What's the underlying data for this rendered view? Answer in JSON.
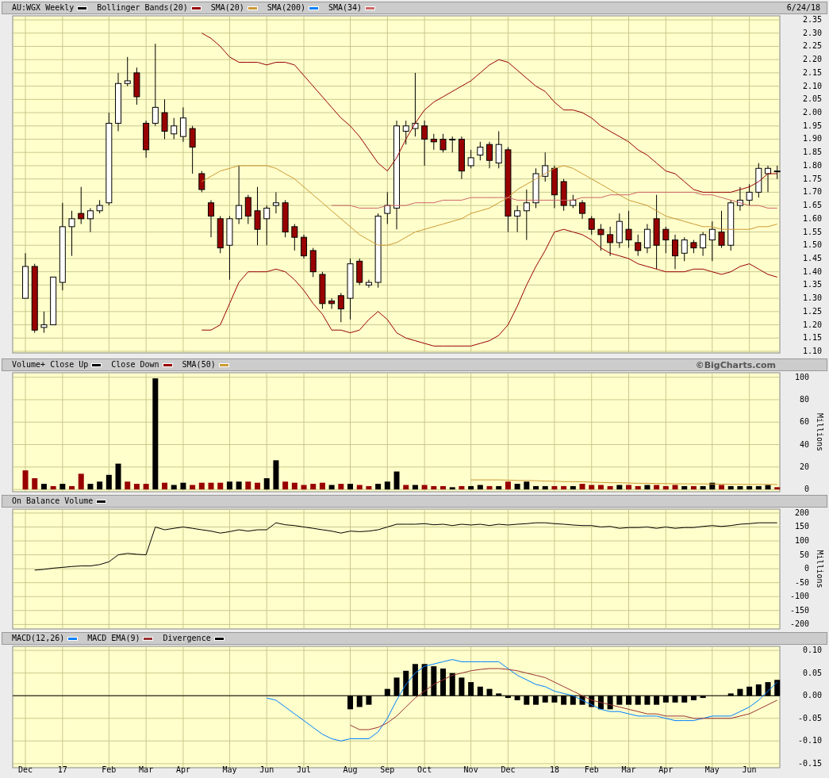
{
  "panels": [
    {
      "legend": [
        {
          "label": "AU:WGX Weekly",
          "color": "#000000"
        },
        {
          "label": "Bollinger Bands(20)",
          "color": "#990000"
        },
        {
          "label": "SMA(20)",
          "color": "#cc9933"
        },
        {
          "label": "SMA(200)",
          "color": "#0080ff"
        },
        {
          "label": "SMA(34)",
          "color": "#cc6666"
        }
      ],
      "date": "6/24/18",
      "chart_data": {
        "type": "candlestick",
        "grid": true,
        "ylim": [
          1.094,
          2.365
        ],
        "yticks": [
          {
            "value": 2.35,
            "label": "2.35"
          },
          {
            "value": 2.3,
            "label": "2.30"
          },
          {
            "value": 2.25,
            "label": "2.25"
          },
          {
            "value": 2.2,
            "label": "2.20"
          },
          {
            "value": 2.15,
            "label": "2.15"
          },
          {
            "value": 2.1,
            "label": "2.10"
          },
          {
            "value": 2.05,
            "label": "2.05"
          },
          {
            "value": 2.0,
            "label": "2.00"
          },
          {
            "value": 1.95,
            "label": "1.95"
          },
          {
            "value": 1.9,
            "label": "1.90"
          },
          {
            "value": 1.85,
            "label": "1.85"
          },
          {
            "value": 1.8,
            "label": "1.80"
          },
          {
            "value": 1.75,
            "label": "1.75"
          },
          {
            "value": 1.7,
            "label": "1.70"
          },
          {
            "value": 1.65,
            "label": "1.65"
          },
          {
            "value": 1.6,
            "label": "1.60"
          },
          {
            "value": 1.55,
            "label": "1.55"
          },
          {
            "value": 1.5,
            "label": "1.50"
          },
          {
            "value": 1.45,
            "label": "1.45"
          },
          {
            "value": 1.4,
            "label": "1.40"
          },
          {
            "value": 1.35,
            "label": "1.35"
          },
          {
            "value": 1.3,
            "label": "1.30"
          },
          {
            "value": 1.25,
            "label": "1.25"
          },
          {
            "value": 1.2,
            "label": "1.20"
          },
          {
            "value": 1.15,
            "label": "1.15"
          },
          {
            "value": 1.1,
            "label": "1.10"
          }
        ],
        "ohlc": [
          [
            1.3,
            1.47,
            1.3,
            1.42
          ],
          [
            1.42,
            1.43,
            1.17,
            1.18
          ],
          [
            1.19,
            1.25,
            1.17,
            1.2
          ],
          [
            1.2,
            1.38,
            1.2,
            1.38
          ],
          [
            1.36,
            1.66,
            1.33,
            1.57
          ],
          [
            1.57,
            1.63,
            1.46,
            1.6
          ],
          [
            1.62,
            1.72,
            1.58,
            1.6
          ],
          [
            1.6,
            1.64,
            1.55,
            1.63
          ],
          [
            1.63,
            1.67,
            1.62,
            1.65
          ],
          [
            1.66,
            2.0,
            1.65,
            1.96
          ],
          [
            1.96,
            2.15,
            1.93,
            2.11
          ],
          [
            2.11,
            2.21,
            2.1,
            2.12
          ],
          [
            2.15,
            2.17,
            2.03,
            2.06
          ],
          [
            1.96,
            1.97,
            1.83,
            1.86
          ],
          [
            1.96,
            2.26,
            1.95,
            2.02
          ],
          [
            2.0,
            2.05,
            1.9,
            1.93
          ],
          [
            1.92,
            1.98,
            1.9,
            1.95
          ],
          [
            1.91,
            2.02,
            1.89,
            1.98
          ],
          [
            1.94,
            1.95,
            1.77,
            1.87
          ],
          [
            1.77,
            1.78,
            1.7,
            1.71
          ],
          [
            1.66,
            1.67,
            1.53,
            1.61
          ],
          [
            1.6,
            1.61,
            1.47,
            1.49
          ],
          [
            1.5,
            1.61,
            1.37,
            1.6
          ],
          [
            1.6,
            1.8,
            1.58,
            1.65
          ],
          [
            1.68,
            1.69,
            1.58,
            1.61
          ],
          [
            1.63,
            1.72,
            1.5,
            1.56
          ],
          [
            1.6,
            1.65,
            1.5,
            1.64
          ],
          [
            1.65,
            1.7,
            1.62,
            1.66
          ],
          [
            1.66,
            1.67,
            1.53,
            1.55
          ],
          [
            1.57,
            1.58,
            1.48,
            1.53
          ],
          [
            1.53,
            1.54,
            1.45,
            1.46
          ],
          [
            1.48,
            1.49,
            1.38,
            1.4
          ],
          [
            1.39,
            1.4,
            1.26,
            1.28
          ],
          [
            1.29,
            1.3,
            1.26,
            1.28
          ],
          [
            1.31,
            1.32,
            1.21,
            1.26
          ],
          [
            1.3,
            1.45,
            1.22,
            1.43
          ],
          [
            1.44,
            1.45,
            1.35,
            1.36
          ],
          [
            1.35,
            1.37,
            1.34,
            1.36
          ],
          [
            1.36,
            1.62,
            1.34,
            1.61
          ],
          [
            1.62,
            1.7,
            1.58,
            1.65
          ],
          [
            1.64,
            1.97,
            1.56,
            1.95
          ],
          [
            1.93,
            1.97,
            1.88,
            1.95
          ],
          [
            1.94,
            2.15,
            1.91,
            1.96
          ],
          [
            1.95,
            1.97,
            1.8,
            1.9
          ],
          [
            1.9,
            1.92,
            1.86,
            1.89
          ],
          [
            1.9,
            1.92,
            1.85,
            1.86
          ],
          [
            1.9,
            1.91,
            1.85,
            1.9
          ],
          [
            1.9,
            1.91,
            1.75,
            1.78
          ],
          [
            1.8,
            1.86,
            1.79,
            1.83
          ],
          [
            1.84,
            1.89,
            1.82,
            1.87
          ],
          [
            1.88,
            1.89,
            1.79,
            1.82
          ],
          [
            1.81,
            1.93,
            1.79,
            1.88
          ],
          [
            1.86,
            1.87,
            1.55,
            1.61
          ],
          [
            1.61,
            1.65,
            1.55,
            1.63
          ],
          [
            1.63,
            1.71,
            1.52,
            1.66
          ],
          [
            1.66,
            1.79,
            1.64,
            1.77
          ],
          [
            1.76,
            1.85,
            1.74,
            1.8
          ],
          [
            1.79,
            1.8,
            1.64,
            1.69
          ],
          [
            1.74,
            1.75,
            1.63,
            1.65
          ],
          [
            1.65,
            1.69,
            1.64,
            1.67
          ],
          [
            1.66,
            1.67,
            1.6,
            1.62
          ],
          [
            1.6,
            1.61,
            1.54,
            1.56
          ],
          [
            1.56,
            1.58,
            1.48,
            1.54
          ],
          [
            1.54,
            1.57,
            1.46,
            1.51
          ],
          [
            1.51,
            1.62,
            1.49,
            1.59
          ],
          [
            1.56,
            1.63,
            1.49,
            1.52
          ],
          [
            1.51,
            1.54,
            1.46,
            1.48
          ],
          [
            1.49,
            1.58,
            1.47,
            1.56
          ],
          [
            1.6,
            1.69,
            1.41,
            1.5
          ],
          [
            1.56,
            1.57,
            1.47,
            1.52
          ],
          [
            1.52,
            1.54,
            1.41,
            1.46
          ],
          [
            1.47,
            1.53,
            1.44,
            1.52
          ],
          [
            1.51,
            1.52,
            1.47,
            1.49
          ],
          [
            1.49,
            1.55,
            1.46,
            1.54
          ],
          [
            1.52,
            1.59,
            1.44,
            1.56
          ],
          [
            1.55,
            1.63,
            1.49,
            1.5
          ],
          [
            1.5,
            1.67,
            1.48,
            1.66
          ],
          [
            1.65,
            1.72,
            1.63,
            1.67
          ],
          [
            1.67,
            1.73,
            1.65,
            1.7
          ],
          [
            1.7,
            1.81,
            1.68,
            1.79
          ],
          [
            1.77,
            1.8,
            1.7,
            1.79
          ],
          [
            1.78,
            1.8,
            1.75,
            1.78
          ]
        ],
        "series": [
          {
            "type": "line",
            "color": "#990000",
            "values": [
              null,
              null,
              null,
              null,
              null,
              null,
              null,
              null,
              null,
              null,
              null,
              null,
              null,
              null,
              null,
              null,
              null,
              null,
              null,
              2.3,
              2.28,
              2.25,
              2.21,
              2.19,
              2.19,
              2.19,
              2.18,
              2.19,
              2.19,
              2.18,
              2.14,
              2.1,
              2.06,
              2.02,
              1.98,
              1.95,
              1.91,
              1.86,
              1.81,
              1.78,
              1.83,
              1.9,
              1.96,
              2.01,
              2.04,
              2.06,
              2.08,
              2.1,
              2.12,
              2.15,
              2.18,
              2.2,
              2.19,
              2.16,
              2.13,
              2.1,
              2.08,
              2.04,
              2.01,
              2.01,
              2.0,
              1.98,
              1.95,
              1.93,
              1.91,
              1.89,
              1.86,
              1.84,
              1.81,
              1.78,
              1.77,
              1.74,
              1.71,
              1.7,
              1.7,
              1.7,
              1.7,
              1.71,
              1.72,
              1.74,
              1.77,
              1.77
            ]
          },
          {
            "type": "line",
            "color": "#990000",
            "values": [
              null,
              null,
              null,
              null,
              null,
              null,
              null,
              null,
              null,
              null,
              null,
              null,
              null,
              null,
              null,
              null,
              null,
              null,
              null,
              1.18,
              1.18,
              1.2,
              1.28,
              1.36,
              1.4,
              1.4,
              1.4,
              1.41,
              1.4,
              1.37,
              1.33,
              1.28,
              1.24,
              1.18,
              1.18,
              1.17,
              1.18,
              1.22,
              1.25,
              1.22,
              1.17,
              1.15,
              1.14,
              1.13,
              1.12,
              1.12,
              1.12,
              1.12,
              1.12,
              1.13,
              1.14,
              1.16,
              1.2,
              1.27,
              1.35,
              1.42,
              1.48,
              1.55,
              1.56,
              1.55,
              1.54,
              1.52,
              1.49,
              1.47,
              1.46,
              1.45,
              1.43,
              1.42,
              1.41,
              1.4,
              1.4,
              1.4,
              1.41,
              1.41,
              1.4,
              1.39,
              1.4,
              1.42,
              1.43,
              1.41,
              1.39,
              1.38
            ]
          },
          {
            "type": "line",
            "color": "#cc9933",
            "values": [
              null,
              null,
              null,
              null,
              null,
              null,
              null,
              null,
              null,
              null,
              null,
              null,
              null,
              null,
              null,
              null,
              null,
              null,
              null,
              1.74,
              1.76,
              1.78,
              1.79,
              1.8,
              1.8,
              1.8,
              1.8,
              1.79,
              1.77,
              1.75,
              1.72,
              1.69,
              1.66,
              1.63,
              1.6,
              1.57,
              1.54,
              1.52,
              1.5,
              1.5,
              1.51,
              1.53,
              1.55,
              1.56,
              1.57,
              1.58,
              1.59,
              1.6,
              1.62,
              1.63,
              1.64,
              1.66,
              1.68,
              1.71,
              1.73,
              1.75,
              1.77,
              1.79,
              1.8,
              1.79,
              1.77,
              1.75,
              1.73,
              1.71,
              1.69,
              1.67,
              1.66,
              1.65,
              1.63,
              1.61,
              1.6,
              1.59,
              1.58,
              1.57,
              1.57,
              1.56,
              1.56,
              1.56,
              1.56,
              1.57,
              1.57,
              1.58
            ]
          },
          {
            "type": "line",
            "color": "#cc6666",
            "values": [
              null,
              null,
              null,
              null,
              null,
              null,
              null,
              null,
              null,
              null,
              null,
              null,
              null,
              null,
              null,
              null,
              null,
              null,
              null,
              null,
              null,
              null,
              null,
              null,
              null,
              null,
              null,
              null,
              null,
              null,
              null,
              null,
              null,
              1.65,
              1.65,
              1.65,
              1.64,
              1.64,
              1.64,
              1.65,
              1.65,
              1.65,
              1.66,
              1.66,
              1.66,
              1.67,
              1.67,
              1.67,
              1.68,
              1.68,
              1.68,
              1.68,
              1.68,
              1.67,
              1.67,
              1.67,
              1.67,
              1.67,
              1.67,
              1.67,
              1.68,
              1.68,
              1.68,
              1.69,
              1.69,
              1.69,
              1.7,
              1.7,
              1.7,
              1.7,
              1.7,
              1.7,
              1.7,
              1.69,
              1.69,
              1.68,
              1.67,
              1.66,
              1.65,
              1.65,
              1.64,
              1.64
            ]
          }
        ]
      }
    },
    {
      "legend": [
        {
          "label": "Volume+ Close Up",
          "color": "#000000"
        },
        {
          "label": "Close Down",
          "color": "#990000"
        },
        {
          "label": "SMA(50)",
          "color": "#cc9933"
        }
      ],
      "credit": "©BigCharts.com",
      "chart_data": {
        "type": "bar",
        "grid": true,
        "ylabel": "Millions",
        "ylim": [
          -2,
          104
        ],
        "yticks": [
          0,
          20,
          40,
          60,
          80,
          100
        ],
        "series": [
          {
            "type": "bar",
            "color": "#000000",
            "values": [
              null,
              null,
              5,
              null,
              5,
              null,
              null,
              5,
              7,
              13,
              23,
              null,
              null,
              null,
              99,
              null,
              4,
              6,
              null,
              null,
              null,
              null,
              7,
              7,
              null,
              null,
              10,
              26,
              null,
              null,
              null,
              null,
              null,
              4,
              null,
              5,
              null,
              null,
              5,
              7,
              16,
              null,
              4,
              null,
              null,
              null,
              2,
              null,
              3,
              4,
              null,
              3,
              null,
              5,
              7,
              3,
              3,
              null,
              null,
              3,
              null,
              null,
              null,
              null,
              4,
              null,
              null,
              4,
              null,
              null,
              null,
              3,
              null,
              3,
              6,
              null,
              3,
              3,
              3,
              3,
              4,
              null
            ]
          },
          {
            "type": "bar",
            "color": "#990000",
            "values": [
              17,
              10,
              null,
              3,
              null,
              3,
              14,
              null,
              null,
              null,
              null,
              7,
              5,
              5,
              null,
              6,
              null,
              null,
              4,
              6,
              6,
              6,
              null,
              null,
              7,
              6,
              null,
              null,
              7,
              6,
              4,
              5,
              6,
              null,
              5,
              null,
              4,
              3,
              null,
              null,
              null,
              4,
              null,
              4,
              3,
              3,
              null,
              3,
              null,
              null,
              3,
              null,
              7,
              null,
              null,
              null,
              null,
              3,
              3,
              null,
              5,
              4,
              4,
              3,
              null,
              4,
              3,
              null,
              4,
              3,
              4,
              null,
              3,
              null,
              null,
              4,
              null,
              null,
              null,
              null,
              null,
              2
            ]
          },
          {
            "type": "line",
            "color": "#cc9933",
            "values": [
              null,
              null,
              null,
              null,
              null,
              null,
              null,
              null,
              null,
              null,
              null,
              null,
              null,
              null,
              null,
              null,
              null,
              null,
              null,
              null,
              null,
              null,
              null,
              null,
              null,
              null,
              null,
              null,
              null,
              null,
              null,
              null,
              null,
              null,
              null,
              null,
              null,
              null,
              null,
              null,
              null,
              null,
              null,
              null,
              null,
              null,
              null,
              null,
              8.5,
              8.5,
              8.5,
              8.5,
              8.3,
              8,
              8,
              7.8,
              7.5,
              7.3,
              7,
              7,
              6.8,
              6.5,
              6.3,
              6,
              6,
              5.8,
              5.5,
              5.5,
              5.3,
              5.2,
              5.1,
              5,
              5,
              4.9,
              4.8,
              4.7,
              4.6,
              4.6,
              4.5,
              4.5,
              4.5,
              4.4
            ]
          }
        ]
      }
    },
    {
      "legend": [
        {
          "label": "On Balance Volume",
          "color": "#000000"
        }
      ],
      "chart_data": {
        "type": "line",
        "grid": true,
        "ylabel": "Millions",
        "ylim": [
          -216,
          214
        ],
        "yticks": [
          200,
          150,
          100,
          50,
          0,
          -50,
          -100,
          -150,
          -200
        ],
        "series": [
          {
            "type": "line",
            "color": "#000000",
            "values": [
              null,
              -5,
              -2,
              2,
              5,
              8,
              10,
              10,
              15,
              25,
              50,
              55,
              52,
              50,
              150,
              140,
              145,
              150,
              145,
              140,
              135,
              128,
              133,
              140,
              135,
              140,
              140,
              165,
              158,
              155,
              150,
              145,
              140,
              135,
              128,
              135,
              133,
              135,
              140,
              150,
              160,
              160,
              160,
              162,
              158,
              160,
              155,
              160,
              157,
              160,
              155,
              160,
              157,
              160,
              162,
              165,
              165,
              162,
              160,
              157,
              155,
              155,
              150,
              152,
              145,
              148,
              148,
              150,
              145,
              150,
              145,
              148,
              148,
              152,
              155,
              152,
              155,
              160,
              162,
              165,
              165,
              165
            ]
          }
        ]
      }
    },
    {
      "legend": [
        {
          "label": "MACD(12,26)",
          "color": "#0080ff"
        },
        {
          "label": "MACD EMA(9)",
          "color": "#993333"
        },
        {
          "label": "Divergence",
          "color": "#000000"
        }
      ],
      "chart_data": {
        "type": "line",
        "grid": true,
        "ylim": [
          -0.159,
          0.109
        ],
        "categories": [
          "Dec",
          null,
          null,
          null,
          "17",
          null,
          null,
          null,
          null,
          "Feb",
          null,
          null,
          null,
          "Mar",
          null,
          null,
          null,
          "Apr",
          null,
          null,
          null,
          null,
          "May",
          null,
          null,
          null,
          "Jun",
          null,
          null,
          null,
          "Jul",
          null,
          null,
          null,
          null,
          "Aug",
          null,
          null,
          null,
          "Sep",
          null,
          null,
          null,
          "Oct",
          null,
          null,
          null,
          null,
          "Nov",
          null,
          null,
          null,
          "Dec",
          null,
          null,
          null,
          null,
          "18",
          null,
          null,
          null,
          "Feb",
          null,
          null,
          null,
          "Mar",
          null,
          null,
          null,
          "Apr",
          null,
          null,
          null,
          null,
          "May",
          null,
          null,
          null,
          "Jun",
          null,
          null,
          null
        ],
        "yticks": [
          {
            "value": 0.1,
            "label": "0.10"
          },
          {
            "value": 0.05,
            "label": "0.05"
          },
          {
            "value": 0,
            "label": "0.00"
          },
          {
            "value": -0.05,
            "label": "-0.05"
          },
          {
            "value": -0.1,
            "label": "-0.10"
          },
          {
            "value": -0.15,
            "label": "-0.15"
          }
        ],
        "series": [
          {
            "type": "bar",
            "color": "#000000",
            "values": [
              null,
              null,
              null,
              null,
              null,
              null,
              null,
              null,
              null,
              null,
              null,
              null,
              null,
              null,
              null,
              null,
              null,
              null,
              null,
              null,
              null,
              null,
              null,
              null,
              null,
              null,
              null,
              null,
              null,
              null,
              null,
              null,
              null,
              null,
              null,
              -0.03,
              -0.025,
              -0.02,
              null,
              0.015,
              0.04,
              0.055,
              0.07,
              0.07,
              0.065,
              0.06,
              0.05,
              0.04,
              0.03,
              0.02,
              0.015,
              0.005,
              -0.005,
              -0.01,
              -0.02,
              -0.02,
              -0.015,
              -0.015,
              -0.02,
              -0.02,
              -0.02,
              -0.025,
              -0.03,
              -0.03,
              -0.02,
              -0.02,
              -0.02,
              -0.02,
              -0.02,
              -0.015,
              -0.015,
              -0.015,
              -0.01,
              -0.005,
              null,
              null,
              0.005,
              0.015,
              0.02,
              0.025,
              0.03,
              0.035
            ]
          },
          {
            "type": "line",
            "color": "#0080ff",
            "values": [
              null,
              null,
              null,
              null,
              null,
              null,
              null,
              null,
              null,
              null,
              null,
              null,
              null,
              null,
              null,
              null,
              null,
              null,
              null,
              null,
              null,
              null,
              null,
              null,
              null,
              null,
              -0.005,
              -0.01,
              -0.025,
              -0.04,
              -0.055,
              -0.07,
              -0.085,
              -0.095,
              -0.1,
              -0.095,
              -0.095,
              -0.095,
              -0.08,
              -0.05,
              -0.01,
              0.025,
              0.05,
              0.065,
              0.07,
              0.075,
              0.08,
              0.075,
              0.075,
              0.075,
              0.075,
              0.075,
              0.06,
              0.045,
              0.035,
              0.025,
              0.02,
              0.01,
              0.005,
              0,
              -0.01,
              -0.02,
              -0.03,
              -0.035,
              -0.035,
              -0.04,
              -0.045,
              -0.045,
              -0.045,
              -0.05,
              -0.055,
              -0.055,
              -0.055,
              -0.05,
              -0.045,
              -0.045,
              -0.045,
              -0.035,
              -0.025,
              -0.01,
              0.01,
              0.03
            ]
          },
          {
            "type": "line",
            "color": "#993333",
            "values": [
              null,
              null,
              null,
              null,
              null,
              null,
              null,
              null,
              null,
              null,
              null,
              null,
              null,
              null,
              null,
              null,
              null,
              null,
              null,
              null,
              null,
              null,
              null,
              null,
              null,
              null,
              null,
              null,
              null,
              null,
              null,
              null,
              null,
              null,
              null,
              -0.065,
              -0.075,
              -0.075,
              -0.07,
              -0.06,
              -0.045,
              -0.025,
              -0.005,
              0.01,
              0.025,
              0.035,
              0.045,
              0.05,
              0.055,
              0.058,
              0.06,
              0.06,
              0.058,
              0.055,
              0.05,
              0.045,
              0.04,
              0.03,
              0.02,
              0.01,
              0,
              -0.01,
              -0.015,
              -0.02,
              -0.025,
              -0.03,
              -0.035,
              -0.04,
              -0.04,
              -0.045,
              -0.045,
              -0.045,
              -0.05,
              -0.05,
              -0.05,
              -0.05,
              -0.05,
              -0.045,
              -0.04,
              -0.03,
              -0.02,
              -0.01
            ]
          }
        ]
      }
    }
  ]
}
